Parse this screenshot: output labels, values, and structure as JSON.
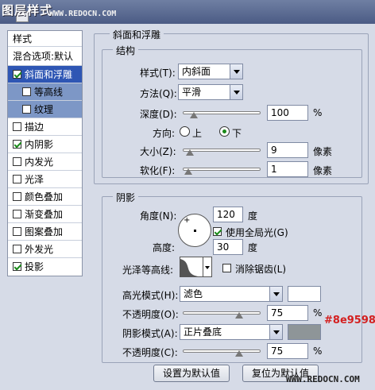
{
  "title": {
    "text": "图层样式",
    "watermark": "WWW.REDOCN.COM"
  },
  "sidebar": {
    "header": "样式",
    "blend": "混合选项:默认",
    "items": [
      {
        "label": "斜面和浮雕",
        "checked": true
      },
      {
        "label": "等高线",
        "checked": false
      },
      {
        "label": "纹理",
        "checked": false
      },
      {
        "label": "描边",
        "checked": false
      },
      {
        "label": "内阴影",
        "checked": true
      },
      {
        "label": "内发光",
        "checked": false
      },
      {
        "label": "光泽",
        "checked": false
      },
      {
        "label": "颜色叠加",
        "checked": false
      },
      {
        "label": "渐变叠加",
        "checked": false
      },
      {
        "label": "图案叠加",
        "checked": false
      },
      {
        "label": "外发光",
        "checked": false
      },
      {
        "label": "投影",
        "checked": true
      }
    ]
  },
  "bevel": {
    "title": "斜面和浮雕",
    "structure_title": "结构",
    "style_label": "样式(T):",
    "style_value": "内斜面",
    "technique_label": "方法(Q):",
    "technique_value": "平滑",
    "depth_label": "深度(D):",
    "depth_value": "100",
    "depth_unit": "%",
    "depth_fraction": 0.1,
    "direction_label": "方向:",
    "dir_up": "上",
    "dir_down": "下",
    "size_label": "大小(Z):",
    "size_value": "9",
    "size_unit": "像素",
    "size_fraction": 0.04,
    "soften_label": "软化(F):",
    "soften_value": "1",
    "soften_unit": "像素",
    "soften_fraction": 0.02
  },
  "shading": {
    "title": "阴影",
    "angle_label": "角度(N):",
    "angle_value": "120",
    "angle_unit": "度",
    "global_light_label": "使用全局光(G)",
    "altitude_label": "高度:",
    "altitude_value": "30",
    "altitude_unit": "度",
    "gloss_label": "光泽等高线:",
    "antialias_label": "消除锯齿(L)",
    "highlight_label": "高光模式(H):",
    "highlight_value": "滤色",
    "highlight_color": "#ffffff",
    "hl_opacity_label": "不透明度(O):",
    "hl_opacity_value": "75",
    "hl_opacity_unit": "%",
    "hl_opacity_fraction": 0.75,
    "shadow_label": "阴影模式(A):",
    "shadow_value": "正片叠底",
    "shadow_color": "#8e9598",
    "shadow_color_text": "#8e9598",
    "sh_opacity_label": "不透明度(C):",
    "sh_opacity_value": "75",
    "sh_opacity_unit": "%",
    "sh_opacity_fraction": 0.75
  },
  "buttons": {
    "make_default": "设置为默认值",
    "reset_default": "复位为默认值"
  },
  "footer_watermark": "WWW.REDOCN.COM"
}
